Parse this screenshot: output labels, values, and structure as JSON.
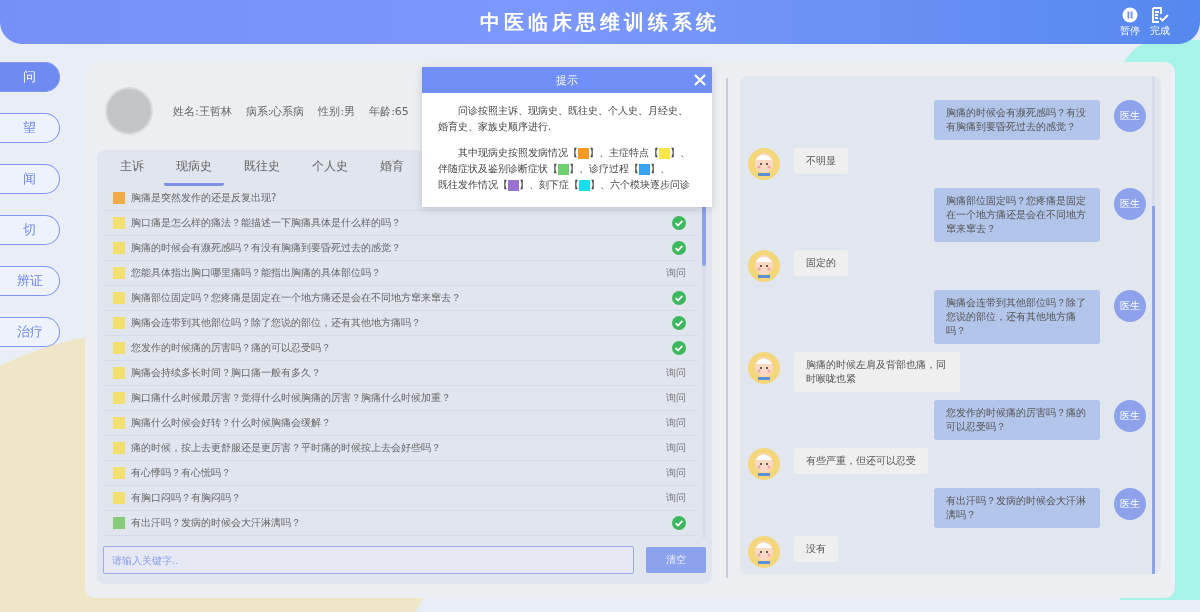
{
  "header": {
    "title": "中医临床思维训练系统",
    "actions": [
      {
        "label": "暂停",
        "kind": "pause"
      },
      {
        "label": "完成",
        "kind": "finish"
      }
    ]
  },
  "steps": [
    {
      "label": "问",
      "selected": true
    },
    {
      "label": "望",
      "selected": false
    },
    {
      "label": "闻",
      "selected": false
    },
    {
      "label": "切",
      "selected": false
    },
    {
      "label": "辨证",
      "selected": false
    },
    {
      "label": "治疗",
      "selected": false
    }
  ],
  "patient": {
    "fields": [
      "姓名:王哲林",
      "病系:心系病",
      "性别:男",
      "年龄:65"
    ]
  },
  "tabs": [
    {
      "label": "主诉",
      "selected": false
    },
    {
      "label": "现病史",
      "selected": true
    },
    {
      "label": "既往史",
      "selected": false
    },
    {
      "label": "个人史",
      "selected": false
    },
    {
      "label": "婚育",
      "selected": false
    }
  ],
  "questions": [
    {
      "text": "胸痛是突然发作的还是反复出现?",
      "color": "#f0ab45",
      "checked": false
    },
    {
      "text": "胸口痛是怎么样的痛法？能描述一下胸痛具体是什么样的吗？",
      "color": "#f2e06e",
      "checked": true
    },
    {
      "text": "胸痛的时候会有濒死感吗？有没有胸痛到要昏死过去的感觉？",
      "color": "#f2e06e",
      "checked": true
    },
    {
      "text": "您能具体指出胸口哪里痛吗？能指出胸痛的具体部位吗？",
      "color": "#f2e06e",
      "checked": false,
      "action": "询问"
    },
    {
      "text": "胸痛部位固定吗？您疼痛是固定在一个地方痛还是会在不同地方窜来窜去？",
      "color": "#f2e06e",
      "checked": true
    },
    {
      "text": "胸痛会连带到其他部位吗？除了您说的部位，还有其他地方痛吗？",
      "color": "#f2e06e",
      "checked": true
    },
    {
      "text": "您发作的时候痛的厉害吗？痛的可以忍受吗？",
      "color": "#f2e06e",
      "checked": true
    },
    {
      "text": "胸痛会持续多长时间？胸口痛一般有多久？",
      "color": "#f2e06e",
      "checked": false,
      "action": "询问"
    },
    {
      "text": "胸口痛什么时候最厉害？觉得什么时候胸痛的厉害？胸痛什么时候加重？",
      "color": "#f2e06e",
      "checked": false,
      "action": "询问"
    },
    {
      "text": "胸痛什么时候会好转？什么时候胸痛会缓解？",
      "color": "#f2e06e",
      "checked": false,
      "action": "询问"
    },
    {
      "text": "痛的时候，按上去更舒服还是更厉害？平时痛的时候按上去会好些吗？",
      "color": "#f2e06e",
      "checked": false,
      "action": "询问"
    },
    {
      "text": "有心悸吗？有心慌吗？",
      "color": "#f2e06e",
      "checked": false,
      "action": "询问"
    },
    {
      "text": "有胸口闷吗？有胸闷吗？",
      "color": "#f2e06e",
      "checked": false,
      "action": "询问"
    },
    {
      "text": "有出汗吗？发病的时候会大汗淋漓吗？",
      "color": "#88cc7a",
      "checked": true
    }
  ],
  "search": {
    "placeholder": "请输入关键字..",
    "button": "清空"
  },
  "chat": [
    {
      "kind": "doctor",
      "avatar": "医生",
      "text": "胸痛的时候会有濒死感吗？有没有胸痛到要昏死过去的感觉？"
    },
    {
      "kind": "patient",
      "text": "不明显"
    },
    {
      "kind": "doctor",
      "avatar": "医生",
      "text": "胸痛部位固定吗？您疼痛是固定在一个地方痛还是会在不同地方窜来窜去？"
    },
    {
      "kind": "patient",
      "text": "固定的"
    },
    {
      "kind": "doctor",
      "avatar": "医生",
      "text": "胸痛会连带到其他部位吗？除了您说的部位，还有其他地方痛吗？"
    },
    {
      "kind": "patient",
      "text": "胸痛的时候左肩及背部也痛，同时喉咙也紧"
    },
    {
      "kind": "doctor",
      "avatar": "医生",
      "text": "您发作的时候痛的厉害吗？痛的可以忍受吗？"
    },
    {
      "kind": "patient",
      "text": "有些严重，但还可以忍受"
    },
    {
      "kind": "doctor",
      "avatar": "医生",
      "text": "有出汗吗？发病的时候会大汗淋漓吗？"
    },
    {
      "kind": "patient",
      "text": "没有"
    }
  ],
  "hint_dialog": {
    "title": "提示",
    "paragraph": "问诊按照主诉、现病史、既往史、个人史、月经史、婚育史、家族史顺序进行.",
    "legend_intro": "其中现病史按照",
    "legend": [
      {
        "open": "发病情况【",
        "color": "#f59a23",
        "close": "】、"
      },
      {
        "open": "主症特点【",
        "color": "#fbe64a",
        "close": "】、"
      },
      {
        "open": "伴随症状及鉴别诊断症状【",
        "color": "#6fd06f",
        "close": "】、"
      },
      {
        "open": "诊疗过程【",
        "color": "#3aa3f0",
        "close": "】、"
      },
      {
        "open": "既往发作情况【",
        "color": "#9a70d0",
        "close": "】、"
      },
      {
        "open": "刻下症【",
        "color": "#19dcef",
        "close": "】、"
      }
    ],
    "legend_outro": "六个模块逐步问诊"
  }
}
